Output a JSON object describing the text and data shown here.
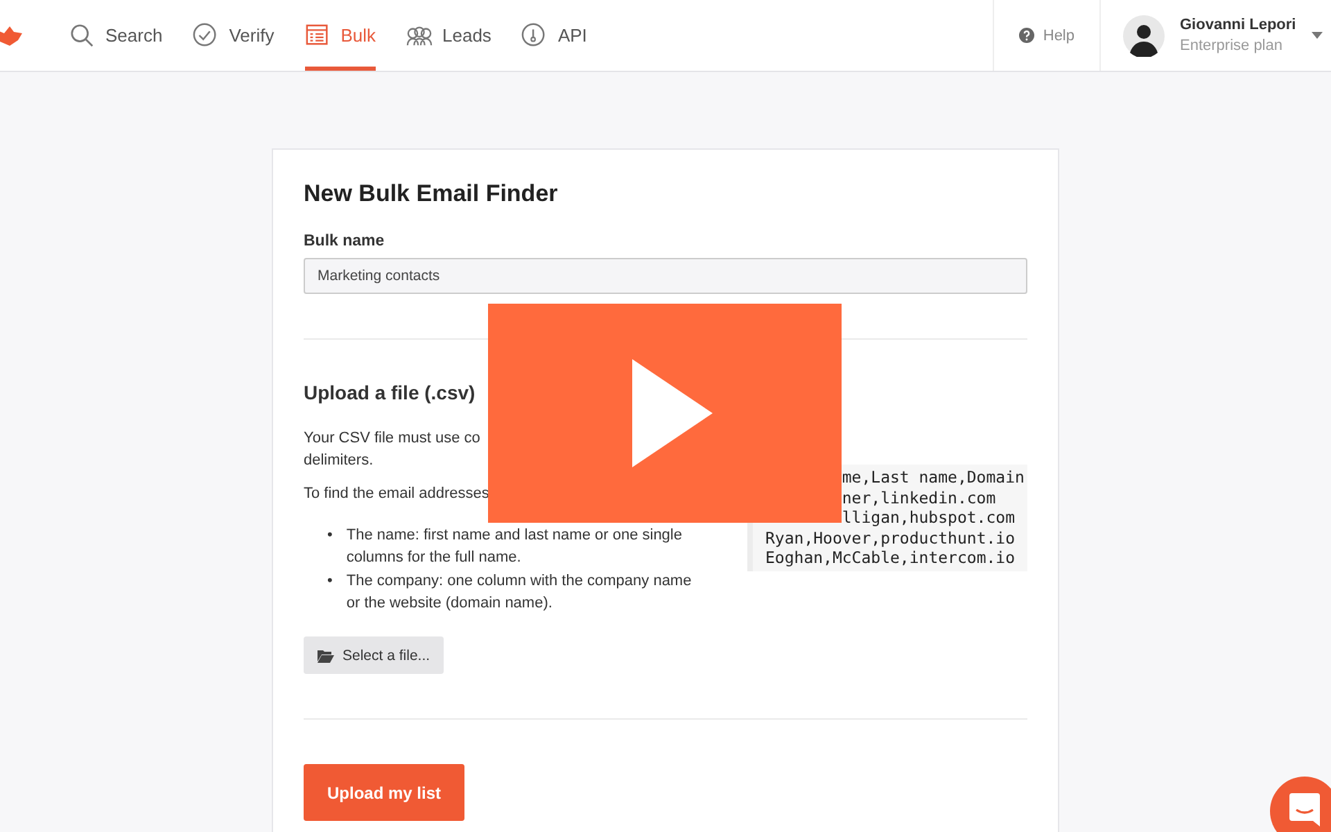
{
  "nav": {
    "tabs": [
      {
        "label": "Search",
        "kind": "search",
        "selected": false
      },
      {
        "label": "Verify",
        "kind": "verify",
        "selected": false
      },
      {
        "label": "Bulk",
        "kind": "bulk",
        "selected": true
      },
      {
        "label": "Leads",
        "kind": "leads",
        "selected": false
      },
      {
        "label": "API",
        "kind": "api",
        "selected": false
      }
    ],
    "help": "Help",
    "user": {
      "name": "Giovanni Lepori",
      "plan": "Enterprise plan"
    }
  },
  "form": {
    "title": "New Bulk Email Finder",
    "name_label": "Bulk name",
    "name_value": "Marketing contacts",
    "upload_title": "Upload a file (.csv)",
    "paragraphs": [
      [
        "Your CSV file must use co",
        "delimiters."
      ],
      [
        "To find the email addresses"
      ]
    ],
    "bullets": [
      {
        "marker": "•",
        "text": "The name: first name and last name or one single columns for the full name."
      },
      {
        "marker": "•",
        "text": "The company: one column with the company name or the website (domain name)."
      }
    ],
    "sample_lines": [
      {
        "text": "me,Last name,Domain",
        "partial": true
      },
      {
        "text": "ner,linkedin.com",
        "partial": true
      },
      {
        "text": "lligan,hubspot.com",
        "partial": true
      },
      {
        "text": "Ryan,Hoover,producthunt.io",
        "partial": false
      },
      {
        "text": "Eoghan,McCable,intercom.io",
        "partial": false
      }
    ],
    "select_button": "Select a file...",
    "submit_button": "Upload my list"
  }
}
